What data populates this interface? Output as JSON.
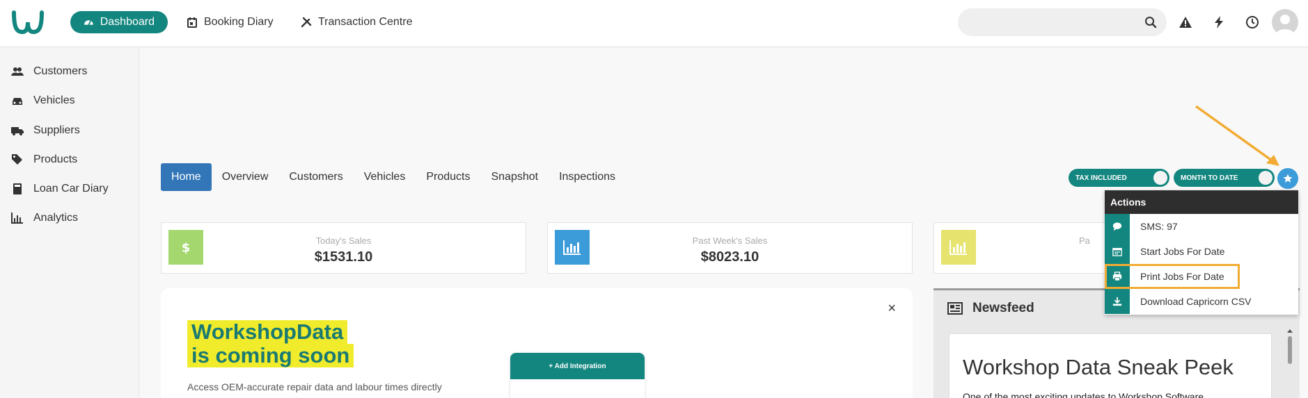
{
  "nav": {
    "dashboard": "Dashboard",
    "booking_diary": "Booking Diary",
    "transaction_centre": "Transaction Centre"
  },
  "sidebar": {
    "items": [
      {
        "label": "Customers",
        "icon": "users-icon"
      },
      {
        "label": "Vehicles",
        "icon": "car-icon"
      },
      {
        "label": "Suppliers",
        "icon": "truck-icon"
      },
      {
        "label": "Products",
        "icon": "tags-icon"
      },
      {
        "label": "Loan Car Diary",
        "icon": "book-icon"
      },
      {
        "label": "Analytics",
        "icon": "bar-chart-icon"
      }
    ]
  },
  "tabs": [
    "Home",
    "Overview",
    "Customers",
    "Vehicles",
    "Products",
    "Snapshot",
    "Inspections"
  ],
  "toggles": {
    "tax": "TAX INCLUDED",
    "period": "MONTH TO DATE"
  },
  "stats": {
    "today_label": "Today's Sales",
    "today_value": "$1531.10",
    "week_label": "Past Week's Sales",
    "week_value": "$8023.10",
    "third_label": "Pa"
  },
  "promo": {
    "line1": "WorkshopData",
    "line2": "is coming soon",
    "text": "Access OEM-accurate repair data and labour times directly",
    "mock_button": "+ Add Integration",
    "close": "×"
  },
  "news": {
    "title": "Newsfeed",
    "heading": "Workshop Data Sneak Peek",
    "sub": "One of the most exciting updates to Workshop Software."
  },
  "actions": {
    "title": "Actions",
    "items": [
      {
        "label": "SMS: 97",
        "icon": "comment-icon"
      },
      {
        "label": "Start Jobs For Date",
        "icon": "calendar-icon"
      },
      {
        "label": "Print Jobs For Date",
        "icon": "printer-icon"
      },
      {
        "label": "Download Capricorn CSV",
        "icon": "download-icon"
      }
    ]
  },
  "colors": {
    "brand": "#13867f",
    "tab_active": "#3276b8",
    "highlight": "#f2ab32",
    "promo_yellow": "#f0ec2b"
  }
}
